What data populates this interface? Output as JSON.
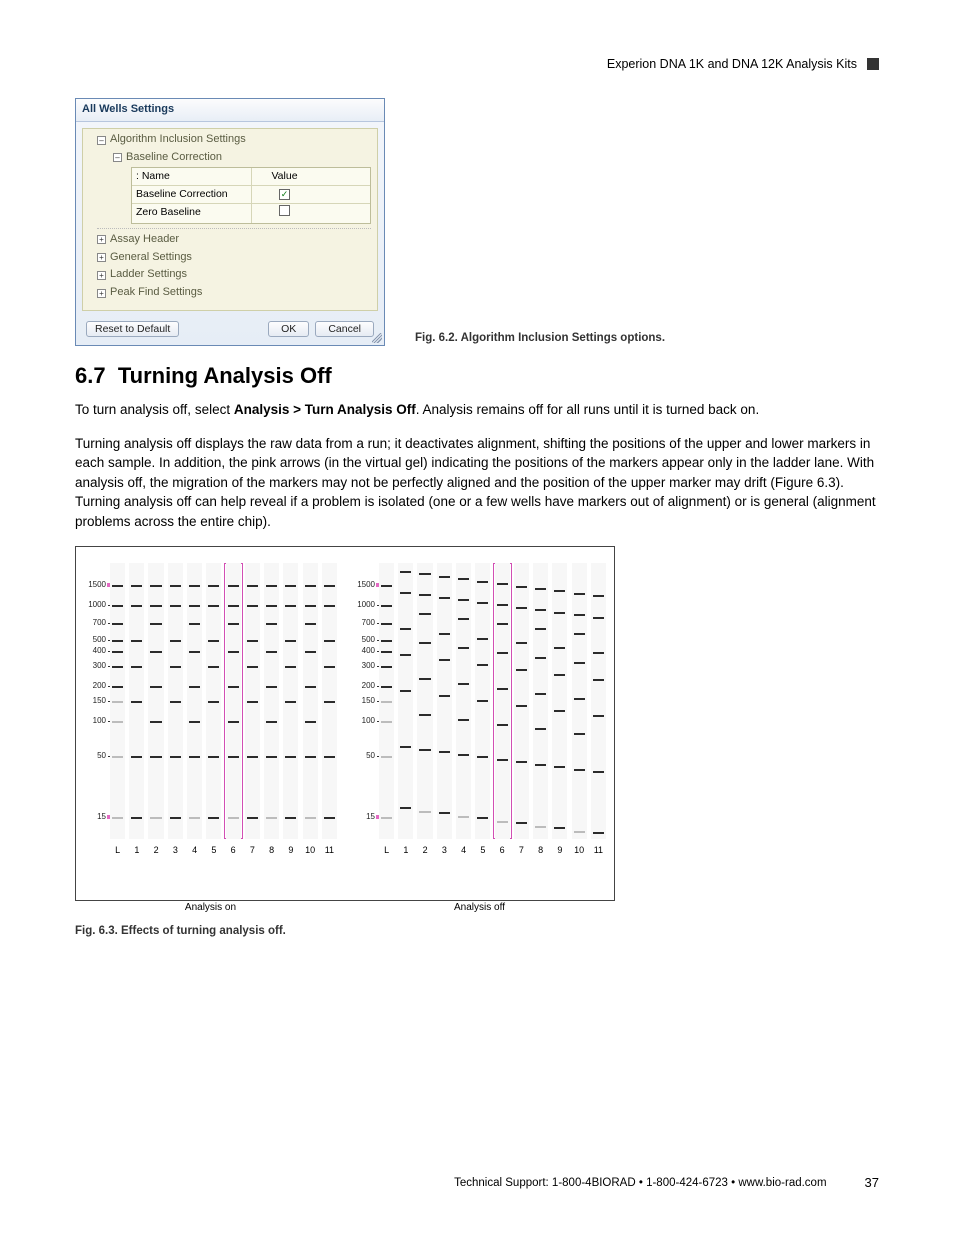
{
  "header": {
    "title": "Experion DNA 1K and DNA 12K Analysis Kits"
  },
  "dialog": {
    "title": "All Wells Settings",
    "tree": {
      "root": "Algorithm Inclusion Settings",
      "child": "Baseline Correction",
      "table": {
        "head_name": "Name",
        "head_value": "Value",
        "rows": [
          {
            "name": "Baseline Correction",
            "checked": true
          },
          {
            "name": "Zero Baseline",
            "checked": false
          }
        ]
      },
      "siblings": [
        "Assay Header",
        "General Settings",
        "Ladder Settings",
        "Peak Find Settings"
      ]
    },
    "buttons": {
      "reset": "Reset to Default",
      "ok": "OK",
      "cancel": "Cancel"
    }
  },
  "fig62_caption": "Fig. 6.2. Algorithm Inclusion Settings options.",
  "section": {
    "number": "6.7",
    "title": "Turning Analysis Off",
    "p1_a": "To turn analysis off, select ",
    "p1_b": "Analysis > Turn Analysis Off",
    "p1_c": ". Analysis remains off for all runs until it is turned back on.",
    "p2": "Turning analysis off displays the raw data from a run; it deactivates alignment, shifting the positions of the upper and lower markers in each sample. In addition, the pink arrows (in the virtual gel) indicating the positions of the markers appear only in the ladder lane. With analysis off, the migration of the markers may not be perfectly aligned and the position of the upper marker may drift (Figure 6.3). Turning analysis off can help reveal if a problem is isolated (one or a few wells have markers out of alignment) or is general (alignment problems across the entire chip)."
  },
  "chart_data": {
    "type": "table",
    "description": "Two virtual gel images side by side showing DNA ladder/sample lanes with and without analysis alignment",
    "y_ticks": [
      1500,
      1000,
      700.0,
      500.0,
      400.0,
      300.0,
      200.0,
      150.0,
      100.0,
      50.0,
      15.0
    ],
    "lane_labels": [
      "L",
      "1",
      "2",
      "3",
      "4",
      "5",
      "6",
      "7",
      "8",
      "9",
      "10",
      "11"
    ],
    "highlight_lane_index": 6,
    "markers": {
      "upper_bp": 1500,
      "lower_bp": 15.0,
      "color": "pink"
    },
    "left_panel": {
      "label": "Analysis on",
      "aligned": true
    },
    "right_panel": {
      "label": "Analysis off",
      "aligned": false
    }
  },
  "fig63_caption": "Fig. 6.3. Effects of turning analysis off.",
  "footer": {
    "text": "Technical Support: 1-800-4BIORAD • 1-800-424-6723 • www.bio-rad.com",
    "page": "37"
  }
}
